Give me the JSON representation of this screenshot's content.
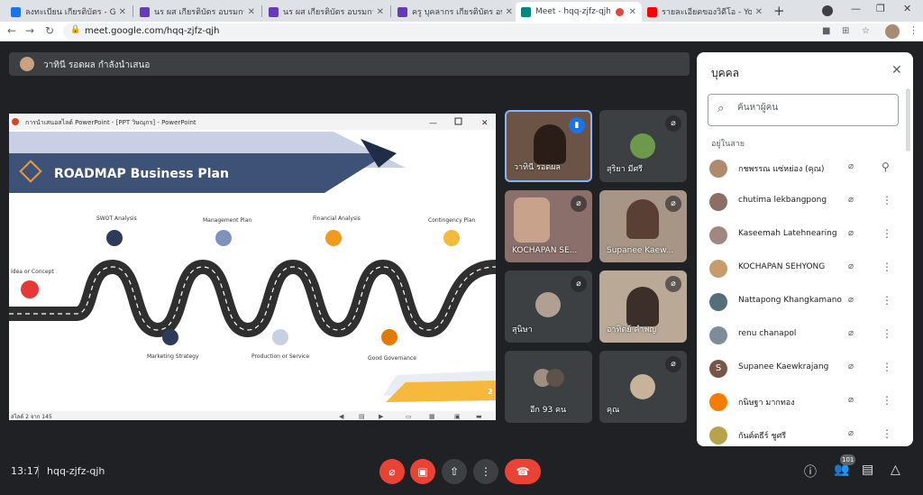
{
  "browser": {
    "tabs": [
      {
        "title": "ลงทะเบียน เกียรติบัตร - Google",
        "color": "#1a73e8"
      },
      {
        "title": "นร ผส เกียรติบัตร อบรมการเขียน",
        "color": "#673ab7"
      },
      {
        "title": "นร ผส เกียรติบัตร อบรมการเขียน",
        "color": "#673ab7"
      },
      {
        "title": "ครู บุคลากร เกียรติบัตร อบรมก",
        "color": "#673ab7"
      },
      {
        "title": "Meet - hqq-zjfz-qjh",
        "color": "#00897b"
      },
      {
        "title": "",
        "color": "#ea4335"
      },
      {
        "title": "รายละเอียดของวิดีโอ - YouTube",
        "color": "#ff0000"
      }
    ],
    "url": "meet.google.com/hqq-zjfz-qjh"
  },
  "presenter_banner": "วาทินี รอดผล กำลังนำเสนอ",
  "slide": {
    "window_title": "การนำเสนอสไลด์ PowerPoint - [PPT วิษณุกร] - PowerPoint",
    "title": "ROADMAP  Business Plan",
    "steps_top": [
      "SWOT Analysis",
      "Management Plan",
      "Financial Analysis",
      "Contingency Plan"
    ],
    "steps_bottom": [
      "Marketing Strategy",
      "Production or Service",
      "Good Governance"
    ],
    "step_left": "Idea or Concept",
    "page_number": "2",
    "status": "สไลด์ 2 จาก 145"
  },
  "tiles": [
    {
      "name": "วาทินี รอดผล"
    },
    {
      "name": "สุริยา มีศรี"
    },
    {
      "name": "KOCHAPAN SE..."
    },
    {
      "name": "Supanee Kaew..."
    },
    {
      "name": "สุนิษา"
    },
    {
      "name": "อาทิตย์ คำพญ"
    },
    {
      "name": "อีก 93 คน"
    },
    {
      "name": "คุณ"
    }
  ],
  "people_panel": {
    "title": "บุคคล",
    "search_placeholder": "ค้นหาผู้คน",
    "section": "อยู่ในสาย",
    "people": [
      {
        "name": "กชพรรณ แซ่หย่อง (คุณ)",
        "avatar": "#b08a6d",
        "letter": ""
      },
      {
        "name": "chutima lekbangpong",
        "avatar": "#8d6e63",
        "letter": ""
      },
      {
        "name": "Kaseemah Latehnearing",
        "avatar": "#a1887f",
        "letter": ""
      },
      {
        "name": "KOCHAPAN SEHYONG",
        "avatar": "#c69c6d",
        "letter": ""
      },
      {
        "name": "Nattapong Khangkamano",
        "avatar": "#546e7a",
        "letter": ""
      },
      {
        "name": "renu chanapol",
        "avatar": "#7e8c9a",
        "letter": ""
      },
      {
        "name": "Supanee Kaewkrajang",
        "avatar": "#795548",
        "letter": "S"
      },
      {
        "name": "กนิษฐา มากทอง",
        "avatar": "#f57c00",
        "letter": ""
      },
      {
        "name": "กันต์ตธีร์ ชูศรี",
        "avatar": "#b7a34a",
        "letter": ""
      }
    ]
  },
  "bottom": {
    "time": "13:17",
    "meeting_code": "hqq-zjfz-qjh",
    "participant_count": "101"
  }
}
